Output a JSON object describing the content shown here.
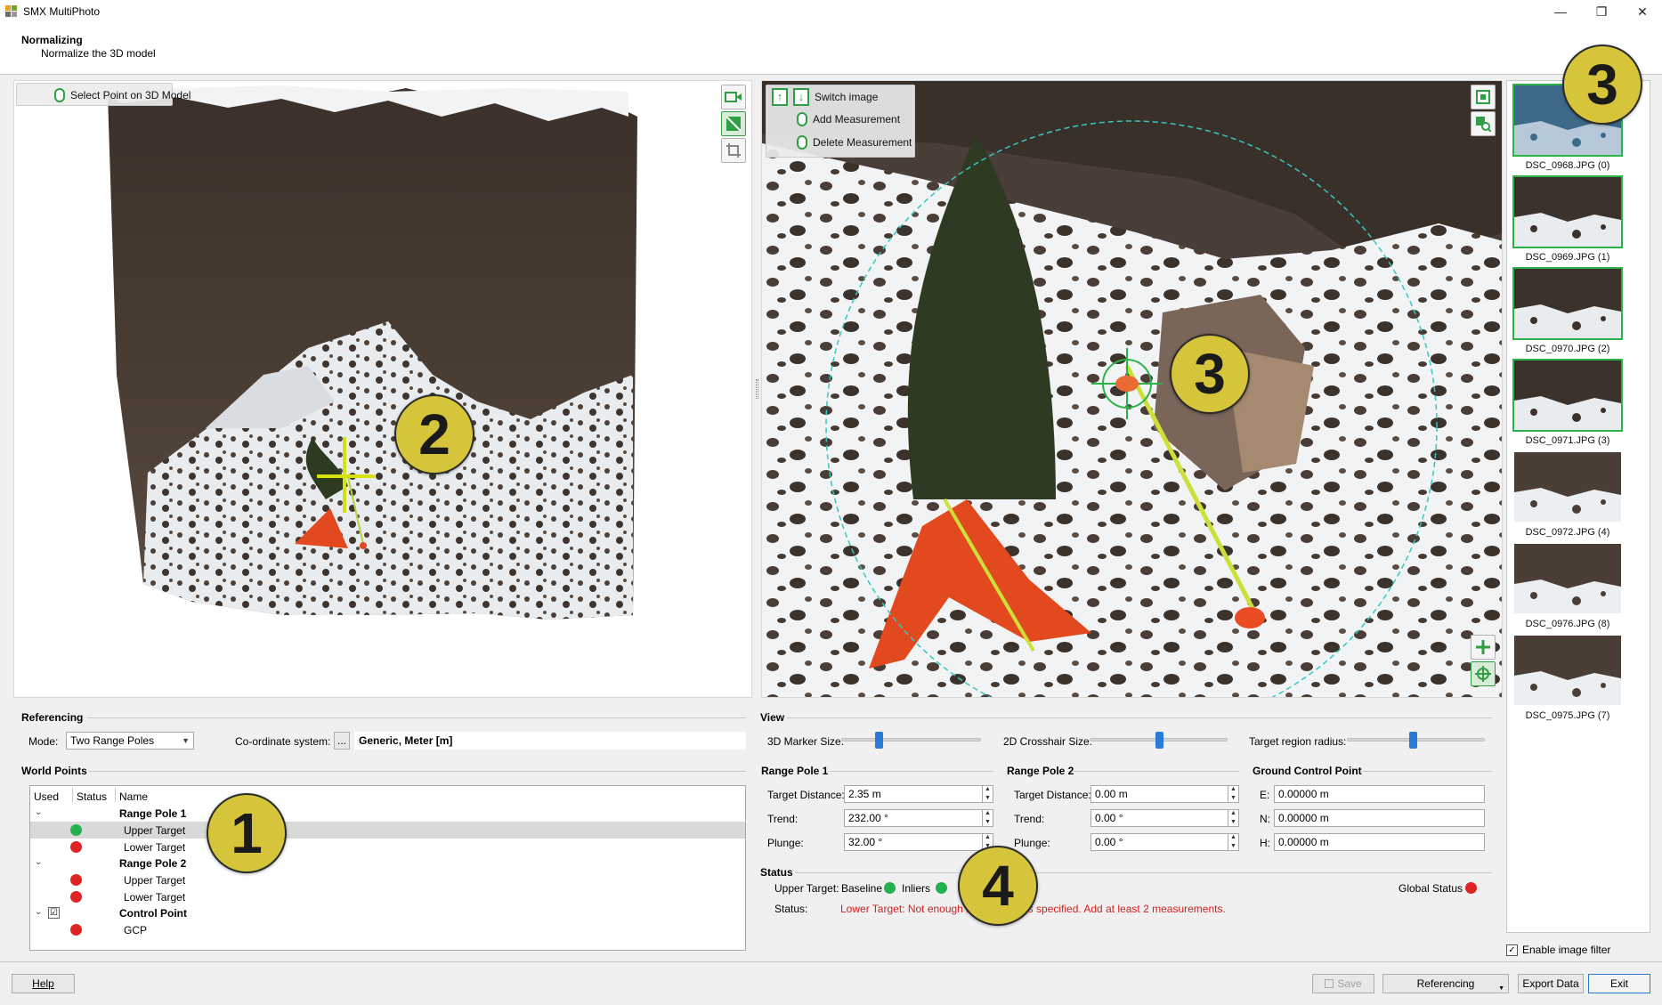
{
  "window": {
    "title": "SMX MultiPhoto"
  },
  "header": {
    "title": "Normalizing",
    "subtitle": "Normalize the 3D model"
  },
  "view3d": {
    "hint_select": "Select Point on 3D Model",
    "badge": "2"
  },
  "view2d": {
    "hint_switch": "Switch image",
    "hint_add": "Add Measurement",
    "hint_delete": "Delete Measurement",
    "badge": "3"
  },
  "thumbnails": {
    "badge": "3",
    "items": [
      {
        "label": "DSC_0968.JPG (0)",
        "active": true
      },
      {
        "label": "DSC_0969.JPG (1)",
        "active": true
      },
      {
        "label": "DSC_0970.JPG (2)",
        "active": true
      },
      {
        "label": "DSC_0971.JPG (3)",
        "active": true
      },
      {
        "label": "DSC_0972.JPG (4)",
        "active": false
      },
      {
        "label": "DSC_0976.JPG (8)",
        "active": false
      },
      {
        "label": "DSC_0975.JPG (7)",
        "active": false
      }
    ],
    "enable_filter_label": "Enable image filter",
    "enable_filter_checked": true
  },
  "referencing": {
    "title": "Referencing",
    "mode_label": "Mode:",
    "mode_value": "Two Range Poles",
    "coord_label": "Co-ordinate system:",
    "coord_button": "...",
    "coord_value": "Generic, Meter [m]"
  },
  "world_points": {
    "title": "World Points",
    "columns": [
      "Used",
      "Status",
      "Name"
    ],
    "badge": "1",
    "rows": [
      {
        "name": "Range Pole 1"
      },
      {
        "name": "Upper Target",
        "status": "green"
      },
      {
        "name": "Lower Target",
        "status": "red"
      },
      {
        "name": "Range Pole 2"
      },
      {
        "name": "Upper Target",
        "status": "red"
      },
      {
        "name": "Lower Target",
        "status": "red"
      },
      {
        "name": "Control Point",
        "used": "☑"
      },
      {
        "name": "GCP",
        "status": "red"
      }
    ]
  },
  "view_settings": {
    "title": "View",
    "marker_size_label": "3D Marker Size:",
    "crosshair_size_label": "2D Crosshair Size:",
    "target_radius_label": "Target region radius:",
    "marker_size_level": 0.27,
    "crosshair_size_level": 0.5,
    "target_radius_level": 0.48
  },
  "range_pole_1": {
    "title": "Range Pole 1",
    "distance_label": "Target Distance:",
    "distance": "2.35 m",
    "trend_label": "Trend:",
    "trend": "232.00 °",
    "plunge_label": "Plunge:",
    "plunge": "32.00 °"
  },
  "range_pole_2": {
    "title": "Range Pole 2",
    "distance_label": "Target Distance:",
    "distance": "0.00 m",
    "trend_label": "Trend:",
    "trend": "0.00 °",
    "plunge_label": "Plunge:",
    "plunge": "0.00 °"
  },
  "gcp": {
    "title": "Ground Control Point",
    "e_label": "E:",
    "e": "0.00000 m",
    "n_label": "N:",
    "n": "0.00000 m",
    "h_label": "H:",
    "h": "0.00000 m"
  },
  "status": {
    "title": "Status",
    "upper_label": "Upper Target:",
    "baseline_label": "Baseline",
    "inliers_label": "Inliers",
    "global_label": "Global Status",
    "status_label": "Status:",
    "status_message": "Lower Target: Not enough in",
    "status_message_tail": "ents specified. Add at least 2 measurements.",
    "badge": "4"
  },
  "buttons": {
    "help": "Help",
    "save": "Save",
    "referencing": "Referencing",
    "export": "Export Data",
    "exit": "Exit"
  },
  "colors": {
    "accent_blue": "#2a7bd4",
    "status_green": "#22b14c",
    "status_red": "#e02424",
    "badge_yellow": "#d6c43a",
    "error_text": "#d21f1f"
  }
}
